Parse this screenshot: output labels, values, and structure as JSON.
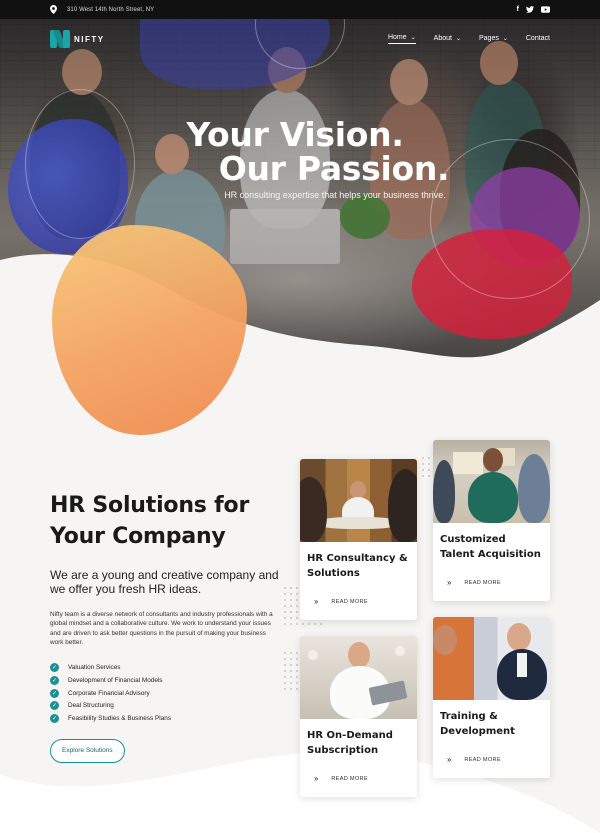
{
  "topbar": {
    "address": "310 West 14th North Street, NY",
    "icons": [
      "map-pin-icon",
      "facebook-icon",
      "twitter-icon",
      "youtube-icon"
    ]
  },
  "nav": {
    "logo_text": "NIFTY",
    "items": [
      {
        "label": "Home",
        "active": true,
        "has_dropdown": true
      },
      {
        "label": "About",
        "active": false,
        "has_dropdown": true
      },
      {
        "label": "Pages",
        "active": false,
        "has_dropdown": true
      },
      {
        "label": "Contact",
        "active": false,
        "has_dropdown": false
      }
    ]
  },
  "hero": {
    "line1": "Your Vision.",
    "line2": "Our Passion.",
    "subtitle": "HR consulting expertise that helps your business thrive."
  },
  "intro": {
    "heading_line1": "HR Solutions for",
    "heading_line2": "Your Company",
    "lead": "We are a young and creative company and we offer you fresh HR ideas.",
    "description": "Nifty team is a diverse network of consultants and industry professionals with a global mindset and a collaborative culture. We work to understand your issues and are driven to ask better questions in the pursuit of making your business work better.",
    "checklist": [
      "Valuation Services",
      "Development of Financial Models",
      "Corporate Financial Advisory",
      "Deal Structuring",
      "Feasibility Studies & Business Plans"
    ],
    "button_label": "Explore Solutions"
  },
  "cards": [
    {
      "title": "HR Consultancy & Solutions",
      "link": "READ MORE"
    },
    {
      "title": "Customized Talent Acquisition",
      "link": "READ MORE"
    },
    {
      "title": "HR On-Demand Subscription",
      "link": "READ MORE"
    },
    {
      "title": "Training & Development",
      "link": "READ MORE"
    }
  ],
  "colors": {
    "accent": "#1a8f94",
    "blob_blue": "#2c2f9e",
    "blob_orange": "#f4a261",
    "blob_red": "#d5203a",
    "blob_violet": "#8d3ea7"
  }
}
